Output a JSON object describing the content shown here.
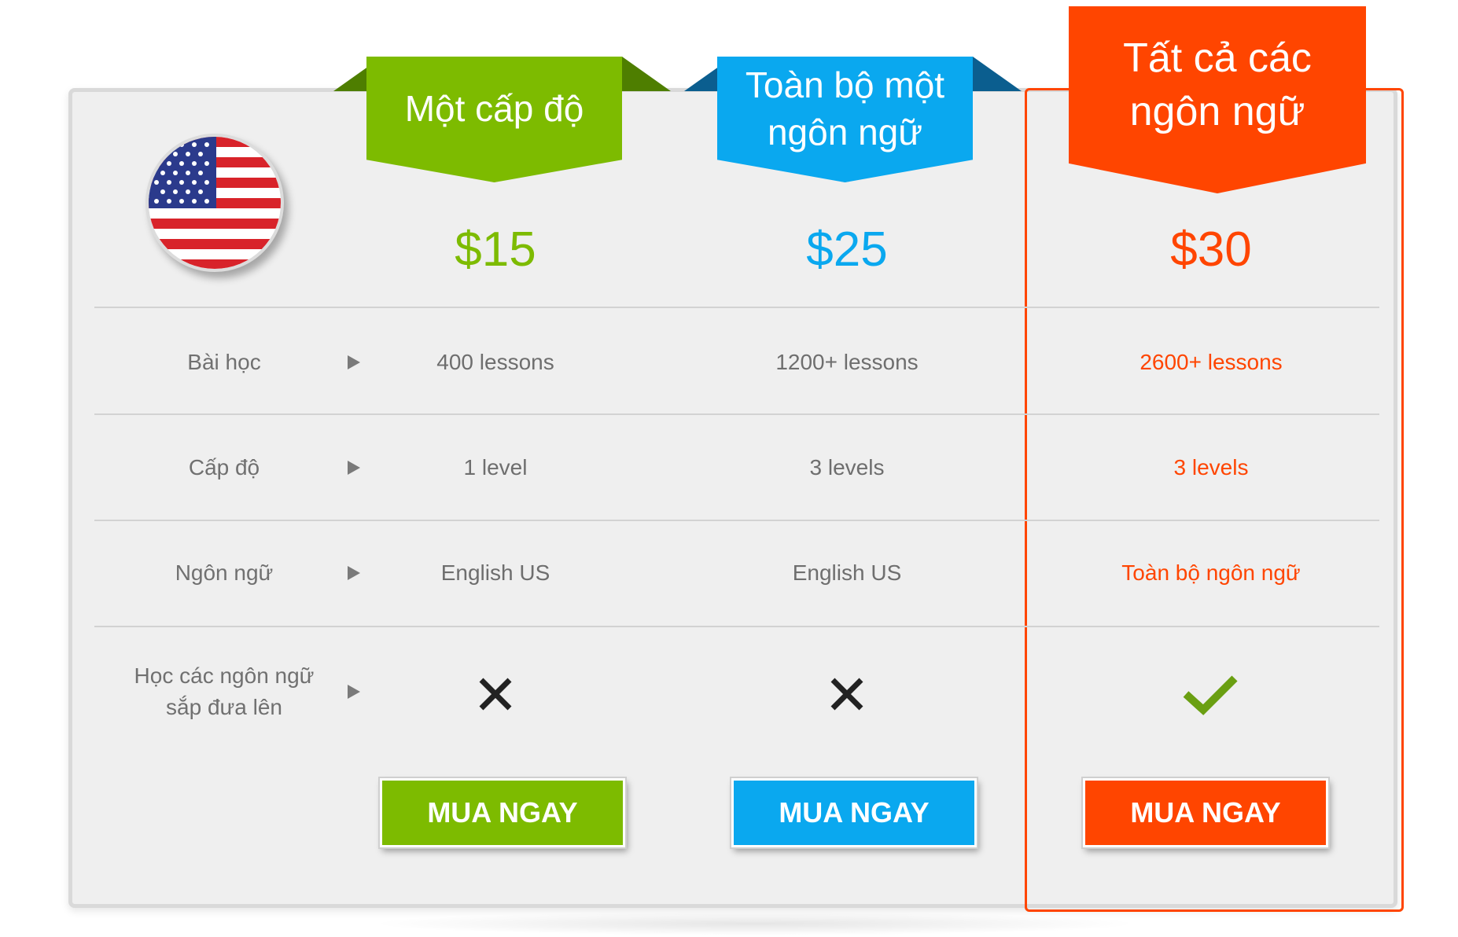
{
  "plans": [
    {
      "title": "Một cấp độ",
      "price": "$15",
      "lessons": "400 lessons",
      "levels": "1 level",
      "language": "English US",
      "upcoming": "cross-icon",
      "button": "MUA NGAY",
      "color": "#7dbb00"
    },
    {
      "title": "Toàn bộ một ngôn ngữ",
      "price": "$25",
      "lessons": "1200+ lessons",
      "levels": "3 levels",
      "language": "English US",
      "upcoming": "cross-icon",
      "button": "MUA NGAY",
      "color": "#0aa8ef"
    },
    {
      "title": "Tất cả các ngôn ngữ",
      "price": "$30",
      "lessons": "2600+ lessons",
      "levels": "3 levels",
      "language": "Toàn bộ ngôn ngữ",
      "upcoming": "check-icon",
      "button": "MUA NGAY",
      "color": "#ff4500"
    }
  ],
  "rows": {
    "lessons": "Bài học",
    "levels": "Cấp độ",
    "language": "Ngôn ngữ",
    "upcoming": "Học các ngôn ngữ sắp đưa lên"
  },
  "flag": "us-flag-icon",
  "colors": {
    "green": "#7dbb00",
    "blue": "#0aa8ef",
    "orange": "#ff4500",
    "text_gray": "#6e6e6e"
  }
}
